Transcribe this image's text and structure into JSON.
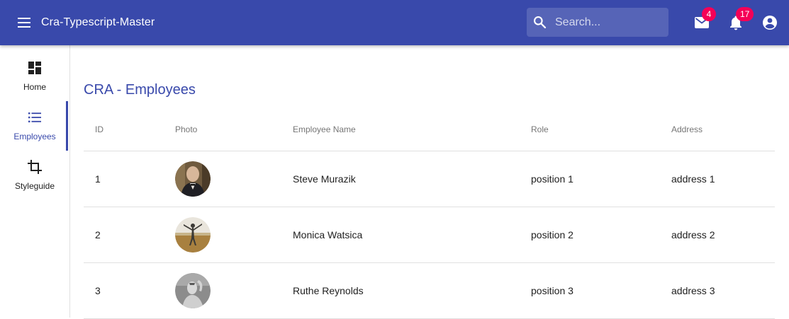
{
  "appbar": {
    "title": "Cra-Typescript-Master",
    "background": "#3949ab",
    "search": {
      "placeholder": "Search...",
      "value": ""
    },
    "mail": {
      "icon": "mail-icon",
      "badge": "4"
    },
    "notifications": {
      "icon": "bell-icon",
      "badge": "17"
    },
    "account": {
      "icon": "account-circle-icon"
    },
    "badge_color": "#f50057"
  },
  "sidebar": {
    "items": [
      {
        "label": "Home",
        "icon": "dashboard-icon",
        "active": false
      },
      {
        "label": "Employees",
        "icon": "list-icon",
        "active": true
      },
      {
        "label": "Styleguide",
        "icon": "crop-icon",
        "active": false
      }
    ]
  },
  "main": {
    "title": "CRA - Employees",
    "table": {
      "columns": [
        "ID",
        "Photo",
        "Employee Name",
        "Role",
        "Address"
      ],
      "rows": [
        {
          "id": "1",
          "name": "Steve Murazik",
          "role": "position 1",
          "address": "address 1"
        },
        {
          "id": "2",
          "name": "Monica Watsica",
          "role": "position 2",
          "address": "address 2"
        },
        {
          "id": "3",
          "name": "Ruthe Reynolds",
          "role": "position 3",
          "address": "address 3"
        }
      ]
    }
  }
}
